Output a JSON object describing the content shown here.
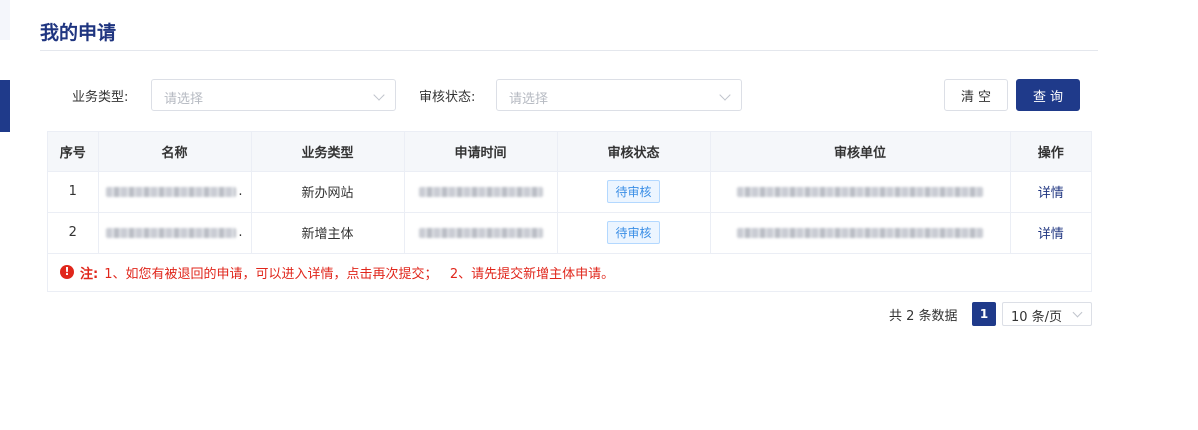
{
  "page": {
    "title": "我的申请"
  },
  "filters": {
    "business_type": {
      "label": "业务类型:",
      "placeholder": "请选择"
    },
    "review_status": {
      "label": "审核状态:",
      "placeholder": "请选择"
    }
  },
  "buttons": {
    "clear": "清空",
    "query": "查询"
  },
  "table": {
    "columns": [
      "序号",
      "名称",
      "业务类型",
      "申请时间",
      "审核状态",
      "审核单位",
      "操作"
    ],
    "rows": [
      {
        "index": "1",
        "name_suffix": ".",
        "business_type": "新办网站",
        "status": "待审核",
        "action": "详情"
      },
      {
        "index": "2",
        "name_suffix": ".",
        "business_type": "新增主体",
        "status": "待审核",
        "action": "详情"
      }
    ],
    "note": {
      "icon": "!",
      "label": "注:",
      "text": "1、如您有被退回的申请，可以进入详情，点击再次提交；   2、请先提交新增主体申请。"
    }
  },
  "pagination": {
    "total_text": "共 2 条数据",
    "current_page": "1",
    "page_size": "10 条/页"
  },
  "colors": {
    "primary": "#1f3a8a",
    "title": "#1f3580",
    "note": "#e0261b",
    "tag": "#3a8ee6"
  }
}
